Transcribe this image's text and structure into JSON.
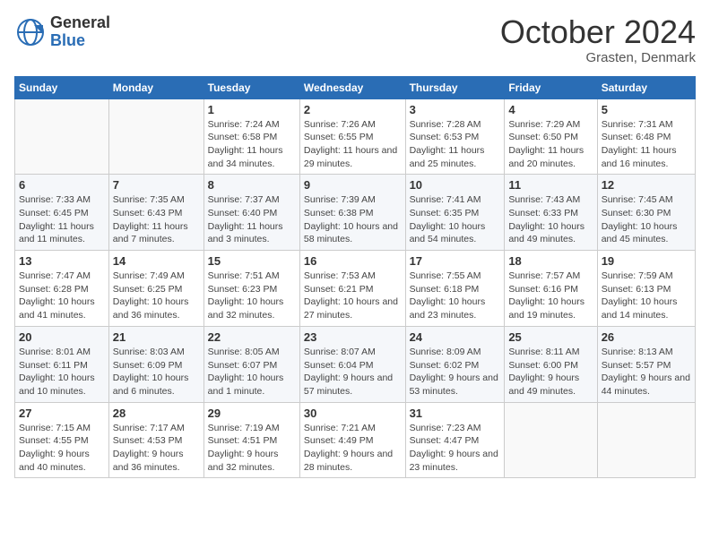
{
  "logo": {
    "general": "General",
    "blue": "Blue"
  },
  "title": {
    "month": "October 2024",
    "location": "Grasten, Denmark"
  },
  "days_of_week": [
    "Sunday",
    "Monday",
    "Tuesday",
    "Wednesday",
    "Thursday",
    "Friday",
    "Saturday"
  ],
  "weeks": [
    [
      {
        "num": "",
        "sunrise": "",
        "sunset": "",
        "daylight": ""
      },
      {
        "num": "",
        "sunrise": "",
        "sunset": "",
        "daylight": ""
      },
      {
        "num": "1",
        "sunrise": "Sunrise: 7:24 AM",
        "sunset": "Sunset: 6:58 PM",
        "daylight": "Daylight: 11 hours and 34 minutes."
      },
      {
        "num": "2",
        "sunrise": "Sunrise: 7:26 AM",
        "sunset": "Sunset: 6:55 PM",
        "daylight": "Daylight: 11 hours and 29 minutes."
      },
      {
        "num": "3",
        "sunrise": "Sunrise: 7:28 AM",
        "sunset": "Sunset: 6:53 PM",
        "daylight": "Daylight: 11 hours and 25 minutes."
      },
      {
        "num": "4",
        "sunrise": "Sunrise: 7:29 AM",
        "sunset": "Sunset: 6:50 PM",
        "daylight": "Daylight: 11 hours and 20 minutes."
      },
      {
        "num": "5",
        "sunrise": "Sunrise: 7:31 AM",
        "sunset": "Sunset: 6:48 PM",
        "daylight": "Daylight: 11 hours and 16 minutes."
      }
    ],
    [
      {
        "num": "6",
        "sunrise": "Sunrise: 7:33 AM",
        "sunset": "Sunset: 6:45 PM",
        "daylight": "Daylight: 11 hours and 11 minutes."
      },
      {
        "num": "7",
        "sunrise": "Sunrise: 7:35 AM",
        "sunset": "Sunset: 6:43 PM",
        "daylight": "Daylight: 11 hours and 7 minutes."
      },
      {
        "num": "8",
        "sunrise": "Sunrise: 7:37 AM",
        "sunset": "Sunset: 6:40 PM",
        "daylight": "Daylight: 11 hours and 3 minutes."
      },
      {
        "num": "9",
        "sunrise": "Sunrise: 7:39 AM",
        "sunset": "Sunset: 6:38 PM",
        "daylight": "Daylight: 10 hours and 58 minutes."
      },
      {
        "num": "10",
        "sunrise": "Sunrise: 7:41 AM",
        "sunset": "Sunset: 6:35 PM",
        "daylight": "Daylight: 10 hours and 54 minutes."
      },
      {
        "num": "11",
        "sunrise": "Sunrise: 7:43 AM",
        "sunset": "Sunset: 6:33 PM",
        "daylight": "Daylight: 10 hours and 49 minutes."
      },
      {
        "num": "12",
        "sunrise": "Sunrise: 7:45 AM",
        "sunset": "Sunset: 6:30 PM",
        "daylight": "Daylight: 10 hours and 45 minutes."
      }
    ],
    [
      {
        "num": "13",
        "sunrise": "Sunrise: 7:47 AM",
        "sunset": "Sunset: 6:28 PM",
        "daylight": "Daylight: 10 hours and 41 minutes."
      },
      {
        "num": "14",
        "sunrise": "Sunrise: 7:49 AM",
        "sunset": "Sunset: 6:25 PM",
        "daylight": "Daylight: 10 hours and 36 minutes."
      },
      {
        "num": "15",
        "sunrise": "Sunrise: 7:51 AM",
        "sunset": "Sunset: 6:23 PM",
        "daylight": "Daylight: 10 hours and 32 minutes."
      },
      {
        "num": "16",
        "sunrise": "Sunrise: 7:53 AM",
        "sunset": "Sunset: 6:21 PM",
        "daylight": "Daylight: 10 hours and 27 minutes."
      },
      {
        "num": "17",
        "sunrise": "Sunrise: 7:55 AM",
        "sunset": "Sunset: 6:18 PM",
        "daylight": "Daylight: 10 hours and 23 minutes."
      },
      {
        "num": "18",
        "sunrise": "Sunrise: 7:57 AM",
        "sunset": "Sunset: 6:16 PM",
        "daylight": "Daylight: 10 hours and 19 minutes."
      },
      {
        "num": "19",
        "sunrise": "Sunrise: 7:59 AM",
        "sunset": "Sunset: 6:13 PM",
        "daylight": "Daylight: 10 hours and 14 minutes."
      }
    ],
    [
      {
        "num": "20",
        "sunrise": "Sunrise: 8:01 AM",
        "sunset": "Sunset: 6:11 PM",
        "daylight": "Daylight: 10 hours and 10 minutes."
      },
      {
        "num": "21",
        "sunrise": "Sunrise: 8:03 AM",
        "sunset": "Sunset: 6:09 PM",
        "daylight": "Daylight: 10 hours and 6 minutes."
      },
      {
        "num": "22",
        "sunrise": "Sunrise: 8:05 AM",
        "sunset": "Sunset: 6:07 PM",
        "daylight": "Daylight: 10 hours and 1 minute."
      },
      {
        "num": "23",
        "sunrise": "Sunrise: 8:07 AM",
        "sunset": "Sunset: 6:04 PM",
        "daylight": "Daylight: 9 hours and 57 minutes."
      },
      {
        "num": "24",
        "sunrise": "Sunrise: 8:09 AM",
        "sunset": "Sunset: 6:02 PM",
        "daylight": "Daylight: 9 hours and 53 minutes."
      },
      {
        "num": "25",
        "sunrise": "Sunrise: 8:11 AM",
        "sunset": "Sunset: 6:00 PM",
        "daylight": "Daylight: 9 hours and 49 minutes."
      },
      {
        "num": "26",
        "sunrise": "Sunrise: 8:13 AM",
        "sunset": "Sunset: 5:57 PM",
        "daylight": "Daylight: 9 hours and 44 minutes."
      }
    ],
    [
      {
        "num": "27",
        "sunrise": "Sunrise: 7:15 AM",
        "sunset": "Sunset: 4:55 PM",
        "daylight": "Daylight: 9 hours and 40 minutes."
      },
      {
        "num": "28",
        "sunrise": "Sunrise: 7:17 AM",
        "sunset": "Sunset: 4:53 PM",
        "daylight": "Daylight: 9 hours and 36 minutes."
      },
      {
        "num": "29",
        "sunrise": "Sunrise: 7:19 AM",
        "sunset": "Sunset: 4:51 PM",
        "daylight": "Daylight: 9 hours and 32 minutes."
      },
      {
        "num": "30",
        "sunrise": "Sunrise: 7:21 AM",
        "sunset": "Sunset: 4:49 PM",
        "daylight": "Daylight: 9 hours and 28 minutes."
      },
      {
        "num": "31",
        "sunrise": "Sunrise: 7:23 AM",
        "sunset": "Sunset: 4:47 PM",
        "daylight": "Daylight: 9 hours and 23 minutes."
      },
      {
        "num": "",
        "sunrise": "",
        "sunset": "",
        "daylight": ""
      },
      {
        "num": "",
        "sunrise": "",
        "sunset": "",
        "daylight": ""
      }
    ]
  ]
}
